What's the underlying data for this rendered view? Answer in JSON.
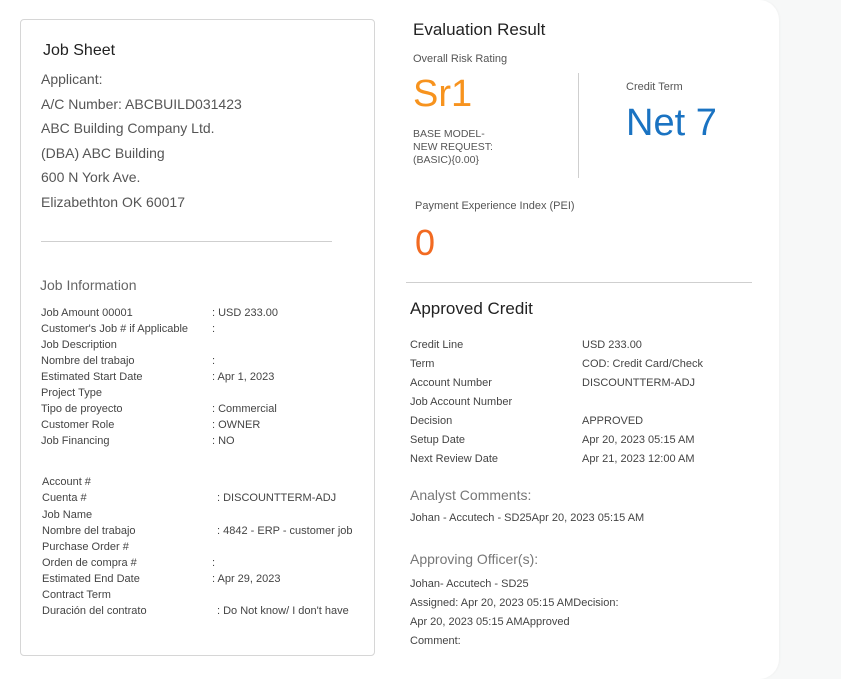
{
  "job_sheet": {
    "title": "Job Sheet",
    "applicant_lines": [
      "Applicant:",
      "A/C Number: ABCBUILD031423",
      "ABC Building Company Ltd.",
      "(DBA) ABC Building",
      "600 N York Ave.",
      "Elizabethton OK 60017"
    ],
    "job_information": {
      "title": "Job Information",
      "rows_a": [
        {
          "label": "Job Amount 00001",
          "value": ": USD 233.00"
        },
        {
          "label": "Customer's Job # if Applicable",
          "value": ":"
        },
        {
          "label": "Job Description",
          "value": ""
        },
        {
          "label": "Nombre del trabajo",
          "value": ":"
        },
        {
          "label": "Estimated Start Date",
          "value": ": Apr 1, 2023"
        },
        {
          "label": "Project Type",
          "value": ""
        },
        {
          "label": "Tipo de proyecto",
          "value": ": Commercial"
        },
        {
          "label": "Customer Role",
          "value": ": OWNER"
        },
        {
          "label": "Job Financing",
          "value": ": NO"
        }
      ],
      "rows_b": [
        {
          "label": "Account #",
          "value": ""
        },
        {
          "label": "Cuenta #",
          "value": ": DISCOUNTTERM-ADJ"
        },
        {
          "label": "Job Name",
          "value": ""
        },
        {
          "label": "Nombre del trabajo",
          "value": ": 4842 - ERP - customer job"
        },
        {
          "label": "Purchase Order #",
          "value": ""
        },
        {
          "label": "Orden de compra #",
          "value": ":"
        },
        {
          "label": "Estimated End Date",
          "value": ": Apr 29, 2023"
        },
        {
          "label": "Contract Term",
          "value": ""
        },
        {
          "label": "Duración del contrato",
          "value": ": Do Not know/ I don't have"
        }
      ]
    }
  },
  "evaluation": {
    "title": "Evaluation Result",
    "risk_label": "Overall Risk Rating",
    "risk_value": "Sr1",
    "risk_model_lines": [
      "BASE MODEL-",
      "NEW REQUEST:",
      "(BASIC){0.00}"
    ],
    "credit_term_label": "Credit Term",
    "credit_term_value": "Net 7",
    "pei_label": "Payment Experience Index (PEI)",
    "pei_value": "0",
    "colors": {
      "risk": "#f7931e",
      "term": "#1a73c2",
      "pei": "#f26a21"
    }
  },
  "approved_credit": {
    "title": "Approved Credit",
    "rows": [
      {
        "label": "Credit Line",
        "value": "USD 233.00"
      },
      {
        "label": "Term",
        "value": "COD: Credit Card/Check"
      },
      {
        "label": "Account Number",
        "value": "DISCOUNTTERM-ADJ"
      },
      {
        "label": "Job Account Number",
        "value": ""
      },
      {
        "label": "Decision",
        "value": "APPROVED"
      },
      {
        "label": "Setup Date",
        "value": "Apr 20, 2023 05:15 AM"
      },
      {
        "label": "Next Review Date",
        "value": "Apr 21, 2023 12:00 AM"
      }
    ],
    "analyst_comments_title": "Analyst Comments:",
    "analyst_comment": "Johan - Accutech - SD25Apr 20, 2023 05:15 AM",
    "approving_officers_title": "Approving Officer(s):",
    "approving_officer_lines": [
      "Johan- Accutech - SD25",
      "Assigned: Apr 20, 2023 05:15 AMDecision:",
      "Apr 20, 2023 05:15 AMApproved",
      "Comment:"
    ]
  }
}
